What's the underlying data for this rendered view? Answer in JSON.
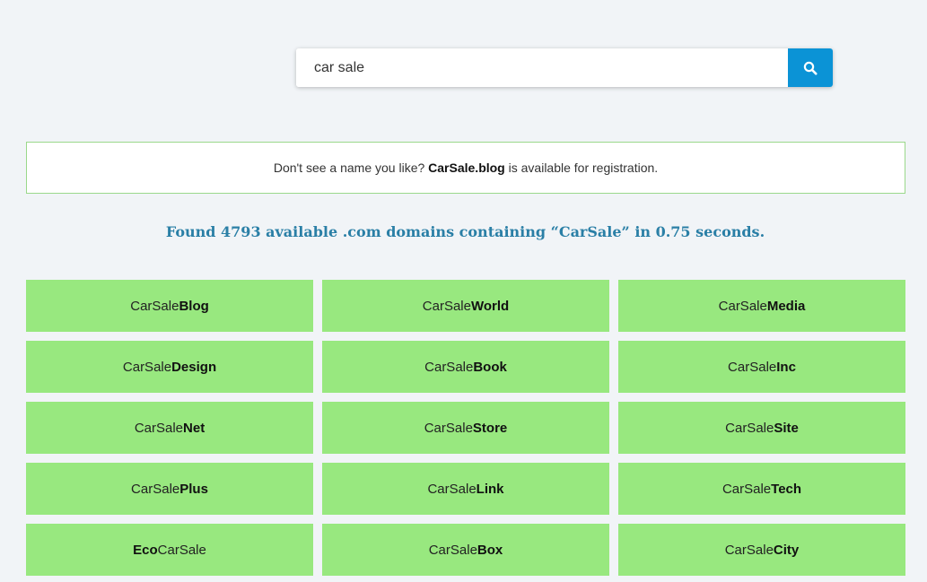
{
  "search": {
    "value": "car sale",
    "button_icon": "search-icon"
  },
  "notice": {
    "prefix": "Don't see a name you like?",
    "domain": "CarSale.blog",
    "suffix": "is available for registration."
  },
  "results_summary": "Found 4793 available .com domains containing “CarSale” in 0.75 seconds.",
  "domains": [
    {
      "plain_before": "CarSale",
      "bold": "Blog",
      "plain_after": ""
    },
    {
      "plain_before": "CarSale",
      "bold": "World",
      "plain_after": ""
    },
    {
      "plain_before": "CarSale",
      "bold": "Media",
      "plain_after": ""
    },
    {
      "plain_before": "CarSale",
      "bold": "Design",
      "plain_after": ""
    },
    {
      "plain_before": "CarSale",
      "bold": "Book",
      "plain_after": ""
    },
    {
      "plain_before": "CarSale",
      "bold": "Inc",
      "plain_after": ""
    },
    {
      "plain_before": "CarSale",
      "bold": "Net",
      "plain_after": ""
    },
    {
      "plain_before": "CarSale",
      "bold": "Store",
      "plain_after": ""
    },
    {
      "plain_before": "CarSale",
      "bold": "Site",
      "plain_after": ""
    },
    {
      "plain_before": "CarSale",
      "bold": "Plus",
      "plain_after": ""
    },
    {
      "plain_before": "CarSale",
      "bold": "Link",
      "plain_after": ""
    },
    {
      "plain_before": "CarSale",
      "bold": "Tech",
      "plain_after": ""
    },
    {
      "plain_before": "",
      "bold": "Eco",
      "plain_after": "CarSale"
    },
    {
      "plain_before": "CarSale",
      "bold": "Box",
      "plain_after": ""
    },
    {
      "plain_before": "CarSale",
      "bold": "City",
      "plain_after": ""
    }
  ],
  "colors": {
    "background": "#f1f4f7",
    "accent_button": "#0b93d6",
    "tile_green": "#98e87f",
    "notice_border": "#9bd88b",
    "summary_text": "#2a7fa6"
  }
}
